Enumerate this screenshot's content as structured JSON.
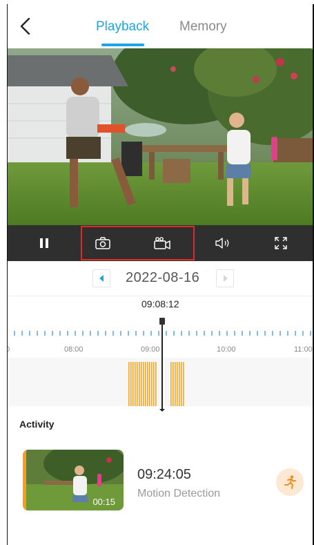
{
  "header": {
    "back_icon": "chevron-left-icon",
    "tabs": [
      {
        "label": "Playback",
        "active": true
      },
      {
        "label": "Memory",
        "active": false
      }
    ],
    "accent_color": "#1aa6e0"
  },
  "player": {
    "controls": [
      {
        "name": "pause-icon"
      },
      {
        "name": "camera-snapshot-icon"
      },
      {
        "name": "video-record-icon"
      },
      {
        "name": "volume-icon"
      },
      {
        "name": "fullscreen-icon"
      }
    ],
    "control_bar_color": "#2f2f2f"
  },
  "date_nav": {
    "date": "2022-08-16",
    "prev_icon": "caret-left-icon",
    "next_icon": "caret-right-icon"
  },
  "timeline": {
    "cursor_time": "09:08:12",
    "labels": [
      "0",
      "08:00",
      "09:00",
      "10:00",
      "11:00"
    ],
    "event_color": "#f5a623"
  },
  "activity": {
    "title": "Activity",
    "items": [
      {
        "time": "09:24:05",
        "type": "Motion Detection",
        "duration": "00:15",
        "icon": "running-person-icon"
      }
    ]
  }
}
